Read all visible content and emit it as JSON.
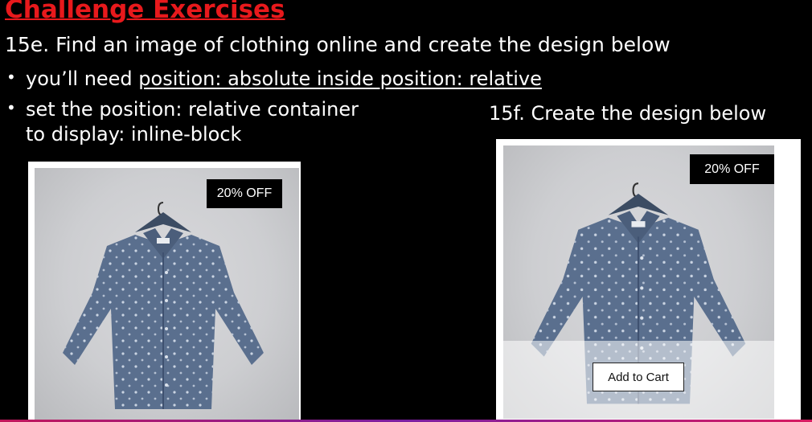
{
  "heading": {
    "title": "Challenge Exercises"
  },
  "exercise_e": {
    "title": "15e. Find an image of clothing online and create the design below",
    "bullets": {
      "b1_prefix": "you’ll need ",
      "b1_code": "position: absolute inside position: relative",
      "b2_line1": "set the position: relative container",
      "b2_line2": "to display: inline-block"
    },
    "badge": "20% OFF"
  },
  "exercise_f": {
    "title": "15f. Create the design below",
    "badge": "20% OFF",
    "button": "Add to Cart"
  },
  "colors": {
    "accent": "#e8191c",
    "shirt": "#5a6f8e",
    "background": "#000000"
  },
  "icons": {
    "bullet": "•"
  }
}
